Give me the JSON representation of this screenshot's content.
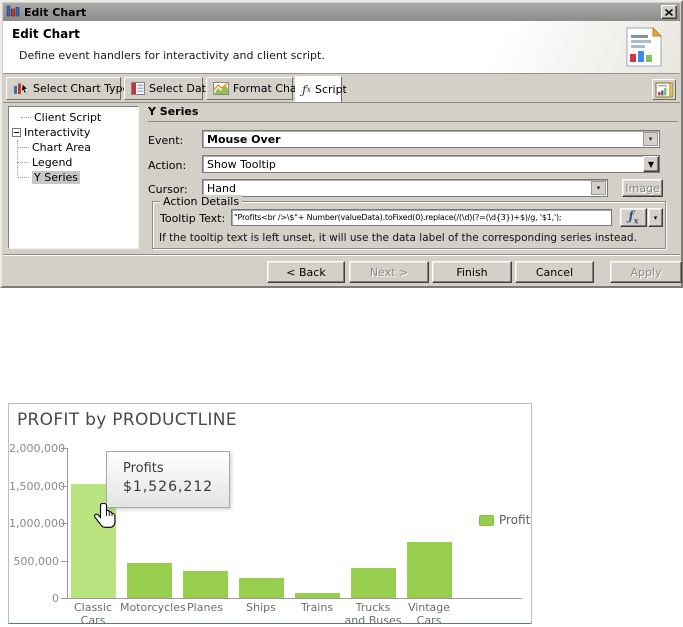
{
  "window": {
    "title": "Edit Chart",
    "header": {
      "title": "Edit Chart",
      "subtitle": "Define event handlers for interactivity and client script."
    },
    "tabs": [
      {
        "label": "Select Chart Type"
      },
      {
        "label": "Select Data"
      },
      {
        "label": "Format Chart"
      },
      {
        "label": "Script"
      }
    ],
    "tree": {
      "items": [
        {
          "label": "Client Script"
        },
        {
          "label": "Interactivity"
        },
        {
          "label": "Chart Area"
        },
        {
          "label": "Legend"
        },
        {
          "label": "Y Series"
        }
      ]
    },
    "panel": {
      "heading": "Y Series",
      "event_label": "Event:",
      "event_value": "Mouse Over",
      "action_label": "Action:",
      "action_value": "Show Tooltip",
      "cursor_label": "Cursor:",
      "cursor_value": "Hand",
      "image_button_label": "Image",
      "group_label": "Action Details",
      "tooltip_label": "Tooltip Text:",
      "tooltip_value": "\"Profits<br />\\$\"+ Number(valueData).toFixed(0).replace(/(\\d)(?=(\\d{3})+$)/g, '$1,');",
      "note": "If the tooltip text is left unset, it will use the data label of the corresponding series instead."
    },
    "buttons": [
      {
        "label": "< Back",
        "enabled": true
      },
      {
        "label": "Next >",
        "enabled": false
      },
      {
        "label": "Finish",
        "enabled": true
      },
      {
        "label": "Cancel",
        "enabled": true
      },
      {
        "label": "Apply",
        "enabled": false
      }
    ]
  },
  "chart_data": {
    "type": "bar",
    "title": "PROFIT by PRODUCTLINE",
    "categories": [
      "Classic Cars",
      "Motorcycles",
      "Planes",
      "Ships",
      "Trains",
      "Trucks and Buses",
      "Vintage Cars"
    ],
    "values": [
      1526212,
      470000,
      365000,
      260000,
      65000,
      400000,
      740000
    ],
    "ylim": [
      0,
      2000000
    ],
    "yticks": [
      "2,000,000",
      "1,500,000",
      "1,000,000",
      "500,000",
      "0"
    ],
    "xlabel": "",
    "ylabel": "",
    "grid": false,
    "legend_position": "right",
    "legend": [
      {
        "label": "Profit",
        "color": "#97ce4e"
      }
    ],
    "bar_color": "#97ce4e",
    "highlight_color": "#b9e47f",
    "highlight_index": 0,
    "tooltip": {
      "title": "Profits",
      "value": "$1,526,212"
    }
  }
}
